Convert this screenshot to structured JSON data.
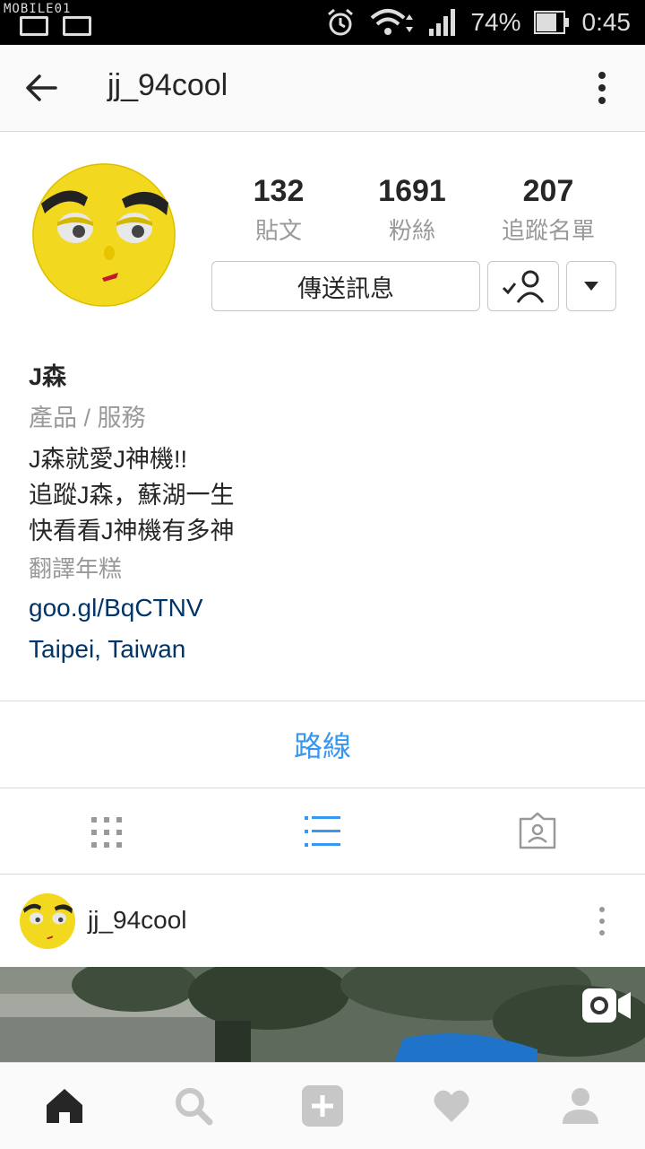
{
  "status_bar": {
    "watermark": "MOBILE01",
    "battery_percent": "74%",
    "time": "0:45"
  },
  "header": {
    "title": "jj_94cool"
  },
  "profile": {
    "stats": [
      {
        "value": "132",
        "label": "貼文"
      },
      {
        "value": "1691",
        "label": "粉絲"
      },
      {
        "value": "207",
        "label": "追蹤名單"
      }
    ],
    "message_button": "傳送訊息",
    "name": "J森",
    "category": "產品 / 服務",
    "bio_lines": [
      "J森就愛J神機!!",
      "追蹤J森，蘇湖一生",
      "快看看J神機有多神"
    ],
    "translate_link": "翻譯年糕",
    "website": "goo.gl/BqCTNV",
    "location": "Taipei, Taiwan"
  },
  "directions": {
    "label": "路線"
  },
  "view_tabs": {
    "active": "list"
  },
  "post": {
    "username": "jj_94cool"
  },
  "colors": {
    "link": "#003569",
    "accent": "#3897f0",
    "text": "#262626",
    "secondary": "#999999"
  },
  "icons": [
    "back-arrow-icon",
    "more-vertical-icon",
    "following-check-icon",
    "dropdown-icon",
    "grid-icon",
    "list-icon",
    "tagged-icon",
    "video-icon",
    "home-icon",
    "search-icon",
    "add-icon",
    "heart-icon",
    "profile-icon"
  ]
}
